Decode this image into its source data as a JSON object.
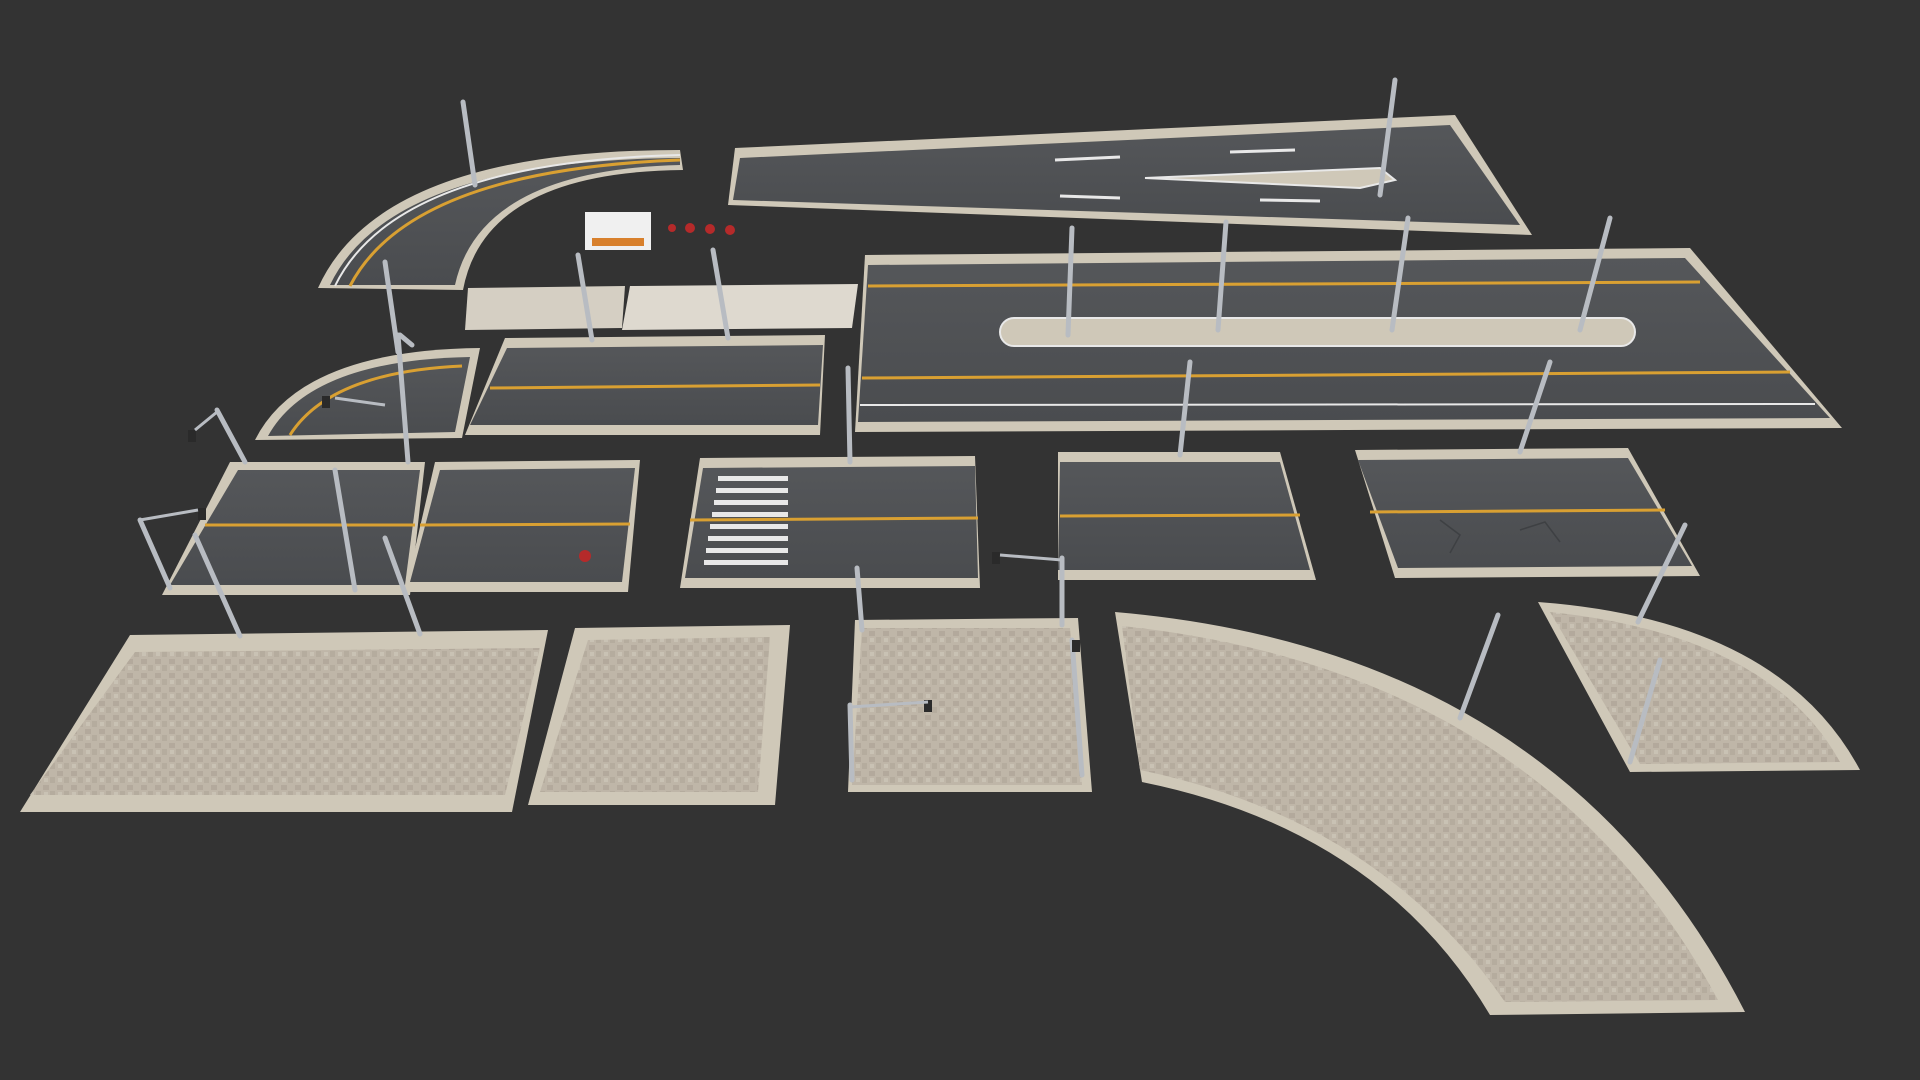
{
  "scene": {
    "description_visible_text": "",
    "background_color": "#333333",
    "colors": {
      "asphalt": "#4e5053",
      "asphalt_light": "#585a5d",
      "curb": "#cfc8b8",
      "curb_shadow": "#8f8a7e",
      "sidewalk": "#bfb6a8",
      "sidewalk_tile": "#a99f92",
      "lane_yellow": "#d9a032",
      "lane_white": "#e8e8e8",
      "pole": "#b8bcc2",
      "pole_dark": "#7d8187",
      "stop_sign": "#b52a2a",
      "shelter": "#f0f0f0",
      "shelter_bench": "#d8802c"
    },
    "pieces": [
      "curved-road-top",
      "merge-road-top",
      "straight-road-median",
      "curved-road-mid",
      "straight-road-mid",
      "intersection-left",
      "intersection-mid",
      "crosswalk-road",
      "straight-road-small",
      "straight-road-cracked",
      "sidewalk-large",
      "sidewalk-small",
      "sidewalk-square",
      "sidewalk-curve-large",
      "sidewalk-curve-small",
      "bus-shelter",
      "sign-group"
    ]
  }
}
